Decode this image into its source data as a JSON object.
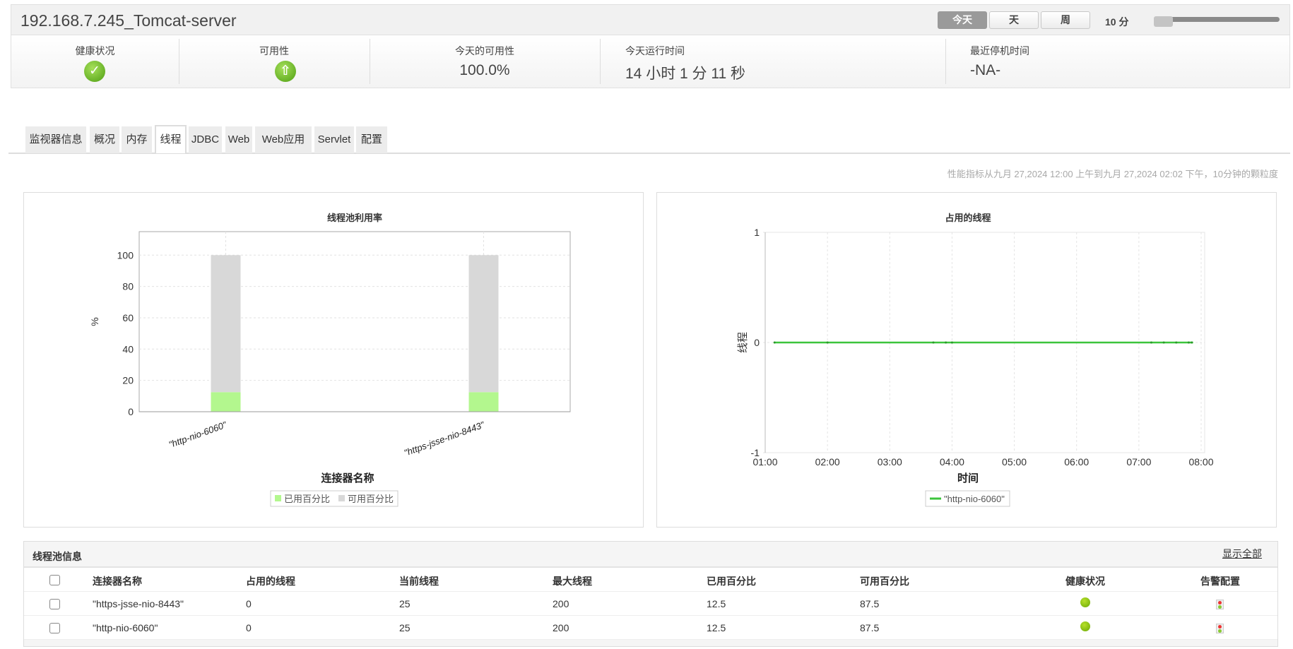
{
  "header": {
    "title": "192.168.7.245_Tomcat-server",
    "period_buttons": [
      "今天",
      "天",
      "周"
    ],
    "granularity": "10 分",
    "slider_position": 0
  },
  "stats": {
    "health": {
      "label": "健康状况",
      "icon": "check-circle-icon"
    },
    "availability": {
      "label": "可用性",
      "icon": "up-arrow-icon"
    },
    "today_availability": {
      "label": "今天的可用性",
      "value": "100.0%"
    },
    "uptime": {
      "label": "今天运行时间",
      "value": "14 小时 1 分 11 秒"
    },
    "last_down": {
      "label": "最近停机时间",
      "value": "-NA-"
    }
  },
  "tabs": [
    "监视器信息",
    "概况",
    "内存",
    "线程",
    "JDBC",
    "Web",
    "Web应用",
    "Servlet",
    "配置"
  ],
  "active_tab": "线程",
  "info_text": "性能指标从九月 27,2024 12:00 上午到九月 27,2024 02:02 下午，10分钟的颗粒度",
  "chart_data": [
    {
      "type": "bar",
      "stacked": true,
      "title": "线程池利用率",
      "xlabel": "连接器名称",
      "ylabel": "%",
      "ylim": [
        0,
        115
      ],
      "yticks": [
        0,
        20,
        40,
        60,
        80,
        100
      ],
      "categories": [
        "\"http-nio-6060\"",
        "\"https-jsse-nio-8443\""
      ],
      "series": [
        {
          "name": "已用百分比",
          "values": [
            12.5,
            12.5
          ],
          "color": "#b3f78e"
        },
        {
          "name": "可用百分比",
          "values": [
            87.5,
            87.5
          ],
          "color": "#d8d8d8"
        }
      ],
      "legend": "bottom",
      "grid": true
    },
    {
      "type": "line",
      "title": "占用的线程",
      "xlabel": "时间",
      "ylabel": "线程",
      "ylim": [
        -1,
        1
      ],
      "yticks": [
        "-1",
        "0",
        "1"
      ],
      "xticks": [
        "01:00",
        "02:00",
        "03:00",
        "04:00",
        "05:00",
        "06:00",
        "07:00",
        "08:00"
      ],
      "series": [
        {
          "name": "\"http-nio-6060\"",
          "color": "#3cc43c",
          "x": [
            1.15,
            2.0,
            3.7,
            3.9,
            4.0,
            7.2,
            7.4,
            7.6,
            7.8,
            7.85
          ],
          "values": [
            0,
            0,
            0,
            0,
            0,
            0,
            0,
            0,
            0,
            0
          ]
        }
      ],
      "legend": "bottom",
      "grid": true
    }
  ],
  "table": {
    "title": "线程池信息",
    "show_all": "显示全部",
    "columns": [
      "连接器名称",
      "占用的线程",
      "当前线程",
      "最大线程",
      "已用百分比",
      "可用百分比",
      "健康状况",
      "告警配置"
    ],
    "rows": [
      [
        "\"https-jsse-nio-8443\"",
        "0",
        "25",
        "200",
        "12.5",
        "87.5"
      ],
      [
        "\"http-nio-6060\"",
        "0",
        "25",
        "200",
        "12.5",
        "87.5"
      ]
    ]
  }
}
